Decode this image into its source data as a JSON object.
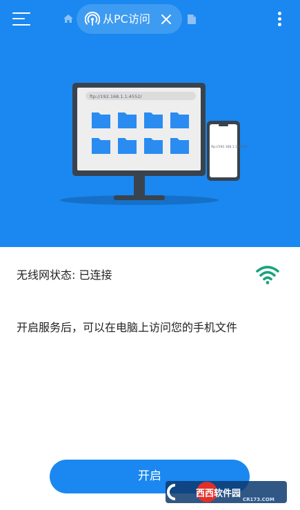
{
  "header": {
    "active_tab_label": "从PC访问"
  },
  "illustration": {
    "monitor_url": "ftp://192.168.1.1:4552/",
    "phone_url": "ftp://192.168.1.1:4552/"
  },
  "status": {
    "wifi_status_text": "无线网状态: 已连接",
    "hint_text": "开启服务后，可以在电脑上访问您的手机文件"
  },
  "actions": {
    "start_label": "开启"
  },
  "watermark": {
    "brand": "西西软件园",
    "site": "CR173.COM"
  },
  "colors": {
    "primary": "#1a88f0",
    "wifi": "#1aa37a",
    "monitor_frame": "#39434d",
    "folder": "#2a8cf0"
  },
  "icons": [
    "menu-icon",
    "home-icon",
    "wifi-tethering-icon",
    "close-icon",
    "file-icon",
    "more-vert-icon",
    "wifi-icon"
  ]
}
